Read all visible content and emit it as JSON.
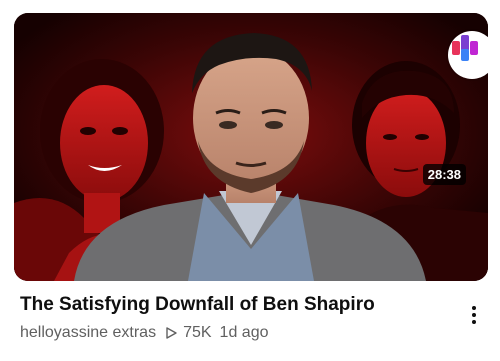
{
  "video": {
    "title": "The Satisfying Downfall of Ben Shapiro",
    "channel": "helloyassine extras",
    "views": "75K",
    "age": "1d ago",
    "duration": "28:38"
  },
  "icons": {
    "views": "play-triangle-icon",
    "menu": "more-vertical-icon",
    "badge": "channel-logo-icon"
  },
  "colors": {
    "thumbnail_bg": "#3a0404",
    "title_text": "#0f0f0f",
    "meta_text": "#606060",
    "duration_bg": "#000000",
    "badge_accent": "#e8335a"
  }
}
